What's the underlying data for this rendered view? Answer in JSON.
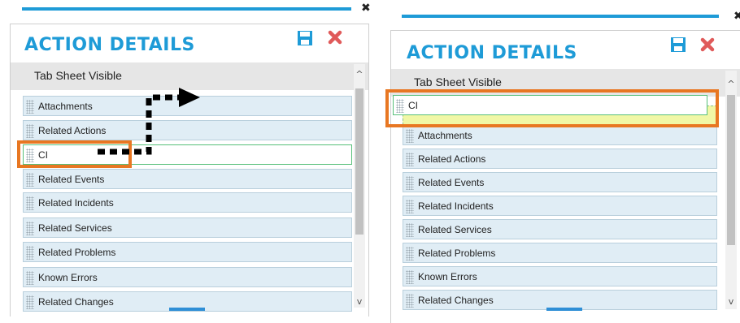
{
  "left": {
    "title": "ACTION DETAILS",
    "tab_header": "Tab Sheet Visible",
    "items": [
      "Attachments",
      "Related Actions",
      "CI",
      "Related Events",
      "Related Incidents",
      "Related Services",
      "Related Problems",
      "Known Errors",
      "Related Changes"
    ]
  },
  "right": {
    "title": "ACTION DETAILS",
    "tab_header": "Tab Sheet Visible",
    "dragged_item": "CI",
    "items": [
      "Attachments",
      "Related Actions",
      "Related Events",
      "Related Incidents",
      "Related Services",
      "Related Problems",
      "Known Errors",
      "Related Changes"
    ]
  },
  "colors": {
    "accent_blue": "#1e9bd7",
    "highlight_orange": "#e87722",
    "delete_red": "#e05a5a",
    "drop_placeholder": "#f1f7a6"
  },
  "icons": {
    "save": "save-icon",
    "delete": "delete-icon",
    "close": "close-icon"
  }
}
